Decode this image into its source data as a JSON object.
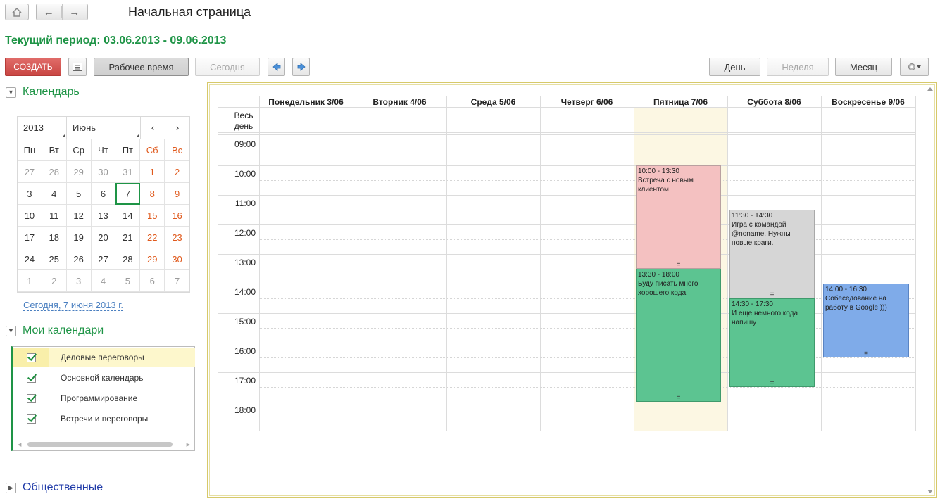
{
  "window": {
    "title": "Начальная страница"
  },
  "nav": {
    "home_icon": "home-icon",
    "back_icon": "arrow-left-icon",
    "forward_icon": "arrow-right-icon"
  },
  "period": {
    "text": "Текущий период: 03.06.2013 - 09.06.2013"
  },
  "toolbar": {
    "create_label": "СОЗДАТЬ",
    "list_icon": "list-view-icon",
    "worktime_label": "Рабочее время",
    "today_label": "Сегодня",
    "prev_icon": "arrow-left-blue-icon",
    "next_icon": "arrow-right-blue-icon",
    "day_label": "День",
    "week_label": "Неделя",
    "month_label": "Месяц",
    "settings_icon": "gear-icon"
  },
  "colors": {
    "brand_green": "#1e9446",
    "create_red": "#c94643",
    "weekend": "#e05a1d"
  },
  "calendar_section": {
    "title": "Календарь",
    "year": "2013",
    "month": "Июнь",
    "prev": "‹",
    "next": "›",
    "weekdays": [
      "Пн",
      "Вт",
      "Ср",
      "Чт",
      "Пт",
      "Сб",
      "Вс"
    ],
    "weeks": [
      [
        "27",
        "28",
        "29",
        "30",
        "31",
        "1",
        "2"
      ],
      [
        "3",
        "4",
        "5",
        "6",
        "7",
        "8",
        "9"
      ],
      [
        "10",
        "11",
        "12",
        "13",
        "14",
        "15",
        "16"
      ],
      [
        "17",
        "18",
        "19",
        "20",
        "21",
        "22",
        "23"
      ],
      [
        "24",
        "25",
        "26",
        "27",
        "28",
        "29",
        "30"
      ],
      [
        "1",
        "2",
        "3",
        "4",
        "5",
        "6",
        "7"
      ]
    ],
    "selected_day": "7",
    "today_link": "Сегодня, 7 июня 2013 г."
  },
  "my_calendars": {
    "title": "Мои календари",
    "items": [
      {
        "label": "Деловые переговоры",
        "checked": true
      },
      {
        "label": "Основной календарь",
        "checked": true
      },
      {
        "label": "Программирование",
        "checked": true
      },
      {
        "label": "Встречи и переговоры",
        "checked": true
      }
    ]
  },
  "public_section": {
    "title": "Общественные"
  },
  "week": {
    "allday_label": "Весь день",
    "days": [
      "Понедельник 3/06",
      "Вторник 4/06",
      "Среда 5/06",
      "Четверг 6/06",
      "Пятница 7/06",
      "Суббота 8/06",
      "Воскресенье 9/06"
    ],
    "hours": [
      "09:00",
      "10:00",
      "11:00",
      "12:00",
      "13:00",
      "14:00",
      "15:00",
      "16:00",
      "17:00",
      "18:00"
    ],
    "events": [
      {
        "time": "10:00 - 13:30",
        "text": "Встреча с новым клиентом",
        "color": "#f4c1c1"
      },
      {
        "time": "13:30 - 18:00",
        "text": "Буду писать много хорошего кода",
        "color": "#5cc491"
      },
      {
        "time": "11:30 - 14:30",
        "text": "Игра с командой @noname. Нужны новые краги.",
        "color": "#d6d6d6"
      },
      {
        "time": "14:30 - 17:30",
        "text": "И еще немного кода напишу",
        "color": "#5cc491"
      },
      {
        "time": "14:00 - 16:30",
        "text": "Собеседование на работу в Google )))",
        "color": "#7fabe9"
      }
    ],
    "grip": "="
  }
}
